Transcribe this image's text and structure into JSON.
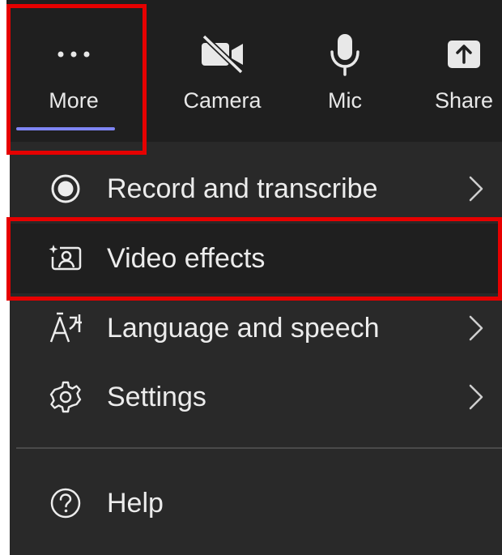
{
  "toolbar": {
    "more": {
      "label": "More",
      "icon": "more-dots-icon",
      "selected": true
    },
    "camera": {
      "label": "Camera",
      "icon": "camera-off-icon"
    },
    "mic": {
      "label": "Mic",
      "icon": "mic-icon"
    },
    "share": {
      "label": "Share",
      "icon": "share-upload-icon"
    }
  },
  "menu": {
    "items": [
      {
        "label": "Record and transcribe",
        "icon": "record-icon",
        "has_submenu": true
      },
      {
        "label": "Video effects",
        "icon": "video-effects-icon",
        "has_submenu": false
      },
      {
        "label": "Language and speech",
        "icon": "language-icon",
        "has_submenu": true
      },
      {
        "label": "Settings",
        "icon": "gear-icon",
        "has_submenu": true
      },
      {
        "label": "Help",
        "icon": "help-icon",
        "has_submenu": false
      }
    ]
  },
  "colors": {
    "toolbar_bg": "#1f1f1f",
    "menu_bg": "#292929",
    "accent_underline": "#7f85f5",
    "highlight_box": "#e60000",
    "text": "#ececec"
  }
}
